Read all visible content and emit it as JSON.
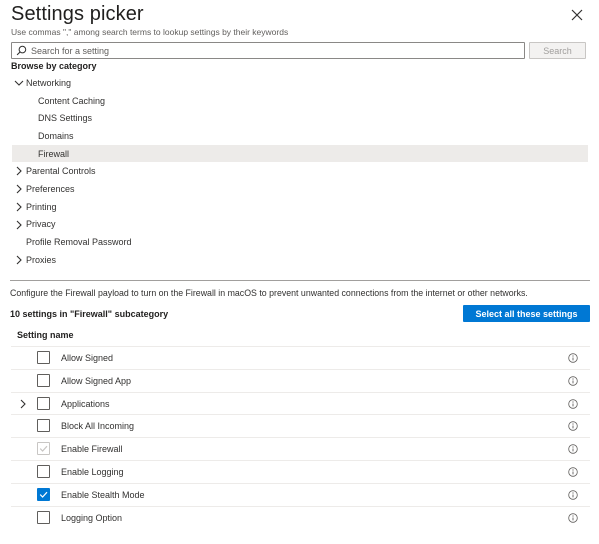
{
  "header": {
    "title": "Settings picker",
    "subtitle": "Use commas \",\" among search terms to lookup settings by their keywords"
  },
  "search": {
    "placeholder": "Search for a setting",
    "button_label": "Search"
  },
  "browse": {
    "label": "Browse by category",
    "tree": [
      {
        "label": "Networking",
        "expanded": true,
        "has_children": true,
        "level": 0,
        "selected": false
      },
      {
        "label": "Content Caching",
        "has_children": false,
        "level": 1,
        "selected": false
      },
      {
        "label": "DNS Settings",
        "has_children": false,
        "level": 1,
        "selected": false
      },
      {
        "label": "Domains",
        "has_children": false,
        "level": 1,
        "selected": false
      },
      {
        "label": "Firewall",
        "has_children": false,
        "level": 1,
        "selected": true
      },
      {
        "label": "Parental Controls",
        "expanded": false,
        "has_children": true,
        "level": 0,
        "selected": false
      },
      {
        "label": "Preferences",
        "expanded": false,
        "has_children": true,
        "level": 0,
        "selected": false
      },
      {
        "label": "Printing",
        "expanded": false,
        "has_children": true,
        "level": 0,
        "selected": false
      },
      {
        "label": "Privacy",
        "expanded": false,
        "has_children": true,
        "level": 0,
        "selected": false
      },
      {
        "label": "Profile Removal Password",
        "has_children": false,
        "level": 0,
        "selected": false
      },
      {
        "label": "Proxies",
        "expanded": false,
        "has_children": true,
        "level": 0,
        "selected": false
      }
    ]
  },
  "details": {
    "description": "Configure the Firewall payload to turn on the Firewall in macOS to prevent unwanted connections from the internet or other networks.",
    "count_label": "10 settings in \"Firewall\" subcategory",
    "select_all_label": "Select all these settings",
    "column_header": "Setting name",
    "settings": [
      {
        "name": "Allow Signed",
        "checked": false,
        "disabled": false,
        "expandable": false
      },
      {
        "name": "Allow Signed App",
        "checked": false,
        "disabled": false,
        "expandable": false
      },
      {
        "name": "Applications",
        "checked": false,
        "disabled": false,
        "expandable": true
      },
      {
        "name": "Block All Incoming",
        "checked": false,
        "disabled": false,
        "expandable": false
      },
      {
        "name": "Enable Firewall",
        "checked": true,
        "disabled": true,
        "expandable": false
      },
      {
        "name": "Enable Logging",
        "checked": false,
        "disabled": false,
        "expandable": false
      },
      {
        "name": "Enable Stealth Mode",
        "checked": true,
        "disabled": false,
        "expandable": false
      },
      {
        "name": "Logging Option",
        "checked": false,
        "disabled": false,
        "expandable": false
      }
    ]
  },
  "colors": {
    "accent": "#0078d4",
    "selected_row": "#edebe9",
    "text": "#323130"
  },
  "icons": {
    "close": "close-icon",
    "search": "search-icon",
    "chevron_down": "chevron-down-icon",
    "chevron_right": "chevron-right-icon",
    "info": "info-icon",
    "checkmark": "checkmark-icon"
  }
}
